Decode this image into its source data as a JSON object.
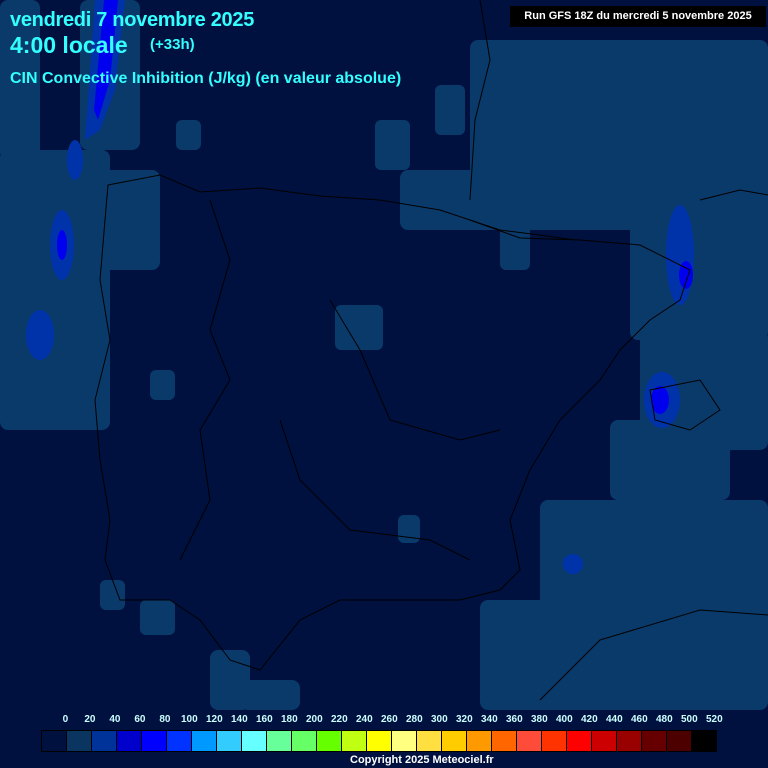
{
  "header": {
    "date": "vendredi 7 novembre 2025",
    "time": "4:00 locale",
    "lead": "(+33h)",
    "parameter": "CIN Convective Inhibition (J/kg) (en valeur absolue)",
    "run": "Run GFS 18Z du mercredi 5 novembre 2025"
  },
  "legend": {
    "labels": [
      "0",
      "20",
      "40",
      "60",
      "80",
      "100",
      "120",
      "140",
      "160",
      "180",
      "200",
      "220",
      "240",
      "260",
      "280",
      "300",
      "320",
      "340",
      "360",
      "380",
      "400",
      "420",
      "440",
      "460",
      "480",
      "500",
      "520"
    ],
    "colors": [
      "#001140",
      "#0a3560",
      "#003399",
      "#0000cc",
      "#0000ff",
      "#0033ff",
      "#0099ff",
      "#33ccff",
      "#66ffff",
      "#66ff99",
      "#66ff66",
      "#66ff00",
      "#c0ff11",
      "#ffff00",
      "#ffff80",
      "#ffe040",
      "#ffcc00",
      "#ff9900",
      "#ff6600",
      "#ff4b3a",
      "#ff3300",
      "#ff0000",
      "#cc0000",
      "#990000",
      "#660000",
      "#4d0000",
      "#000000"
    ]
  },
  "footer": {
    "copyright": "Copyright 2025 Meteociel.fr"
  }
}
